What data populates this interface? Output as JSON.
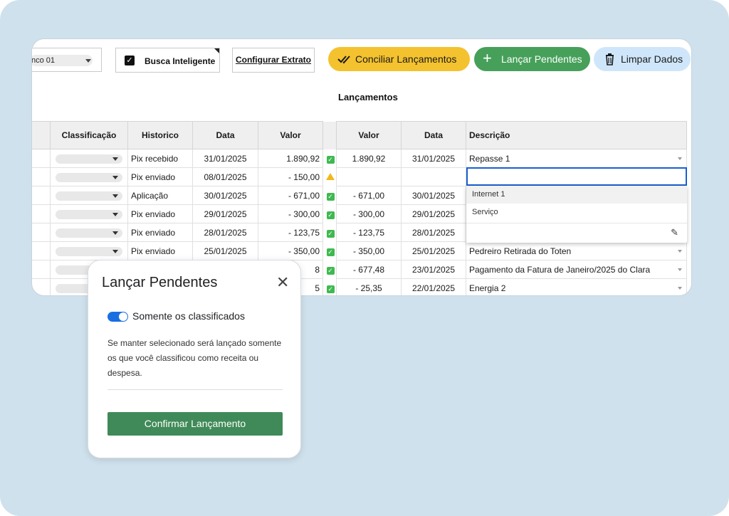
{
  "toolbar": {
    "bank_select_value": "nco 01",
    "smart_search_label": "Busca Inteligente",
    "configure_label": "Configurar Extrato",
    "reconcile_label": "Conciliar Lançamentos",
    "post_pending_label": "Lançar Pendentes",
    "clear_data_label": "Limpar Dados",
    "colors": {
      "reconcile": "#f4c22f",
      "post_pending": "#47a05a",
      "clear_data": "#cfe6fa"
    }
  },
  "section_title": "Lançamentos",
  "left_table": {
    "headers": [
      "Classificação",
      "Historico",
      "Data",
      "Valor"
    ],
    "rows": [
      {
        "historico": "Pix recebido",
        "data": "31/01/2025",
        "valor": "1.890,92",
        "status": "ok"
      },
      {
        "historico": "Pix enviado",
        "data": "08/01/2025",
        "valor": "- 150,00",
        "status": "warn"
      },
      {
        "historico": "Aplicação",
        "data": "30/01/2025",
        "valor": "- 671,00",
        "status": "ok"
      },
      {
        "historico": "Pix enviado",
        "data": "29/01/2025",
        "valor": "- 300,00",
        "status": "ok"
      },
      {
        "historico": "Pix enviado",
        "data": "28/01/2025",
        "valor": "- 123,75",
        "status": "ok"
      },
      {
        "historico": "Pix enviado",
        "data": "25/01/2025",
        "valor": "- 350,00",
        "status": "ok"
      },
      {
        "historico": "",
        "data": "",
        "valor": "8",
        "status": "ok"
      },
      {
        "historico": "",
        "data": "",
        "valor": "5",
        "status": "ok"
      }
    ]
  },
  "right_table": {
    "headers": [
      "Valor",
      "Data",
      "Descrição"
    ],
    "rows": [
      {
        "valor": "1.890,92",
        "data": "31/01/2025",
        "descricao": "Repasse 1"
      },
      {
        "valor": "",
        "data": "",
        "descricao": ""
      },
      {
        "valor": "- 671,00",
        "data": "30/01/2025",
        "descricao": ""
      },
      {
        "valor": "- 300,00",
        "data": "29/01/2025",
        "descricao": ""
      },
      {
        "valor": "- 123,75",
        "data": "28/01/2025",
        "descricao": ""
      },
      {
        "valor": "- 350,00",
        "data": "25/01/2025",
        "descricao": "Pedreiro Retirada do Toten"
      },
      {
        "valor": "- 677,48",
        "data": "23/01/2025",
        "descricao": "Pagamento da Fatura de Janeiro/2025 do Clara"
      },
      {
        "valor": "- 25,35",
        "data": "22/01/2025",
        "descricao": "Energia 2"
      }
    ]
  },
  "dropdown": {
    "options": [
      "Internet 1",
      "Serviço"
    ]
  },
  "dialog": {
    "title": "Lançar Pendentes",
    "close_glyph": "✕",
    "toggle_label": "Somente os classificados",
    "toggle_on": true,
    "description": "Se manter selecionado será lançado somente os que você classificou como receita ou despesa.",
    "confirm_label": "Confirmar Lançamento"
  }
}
